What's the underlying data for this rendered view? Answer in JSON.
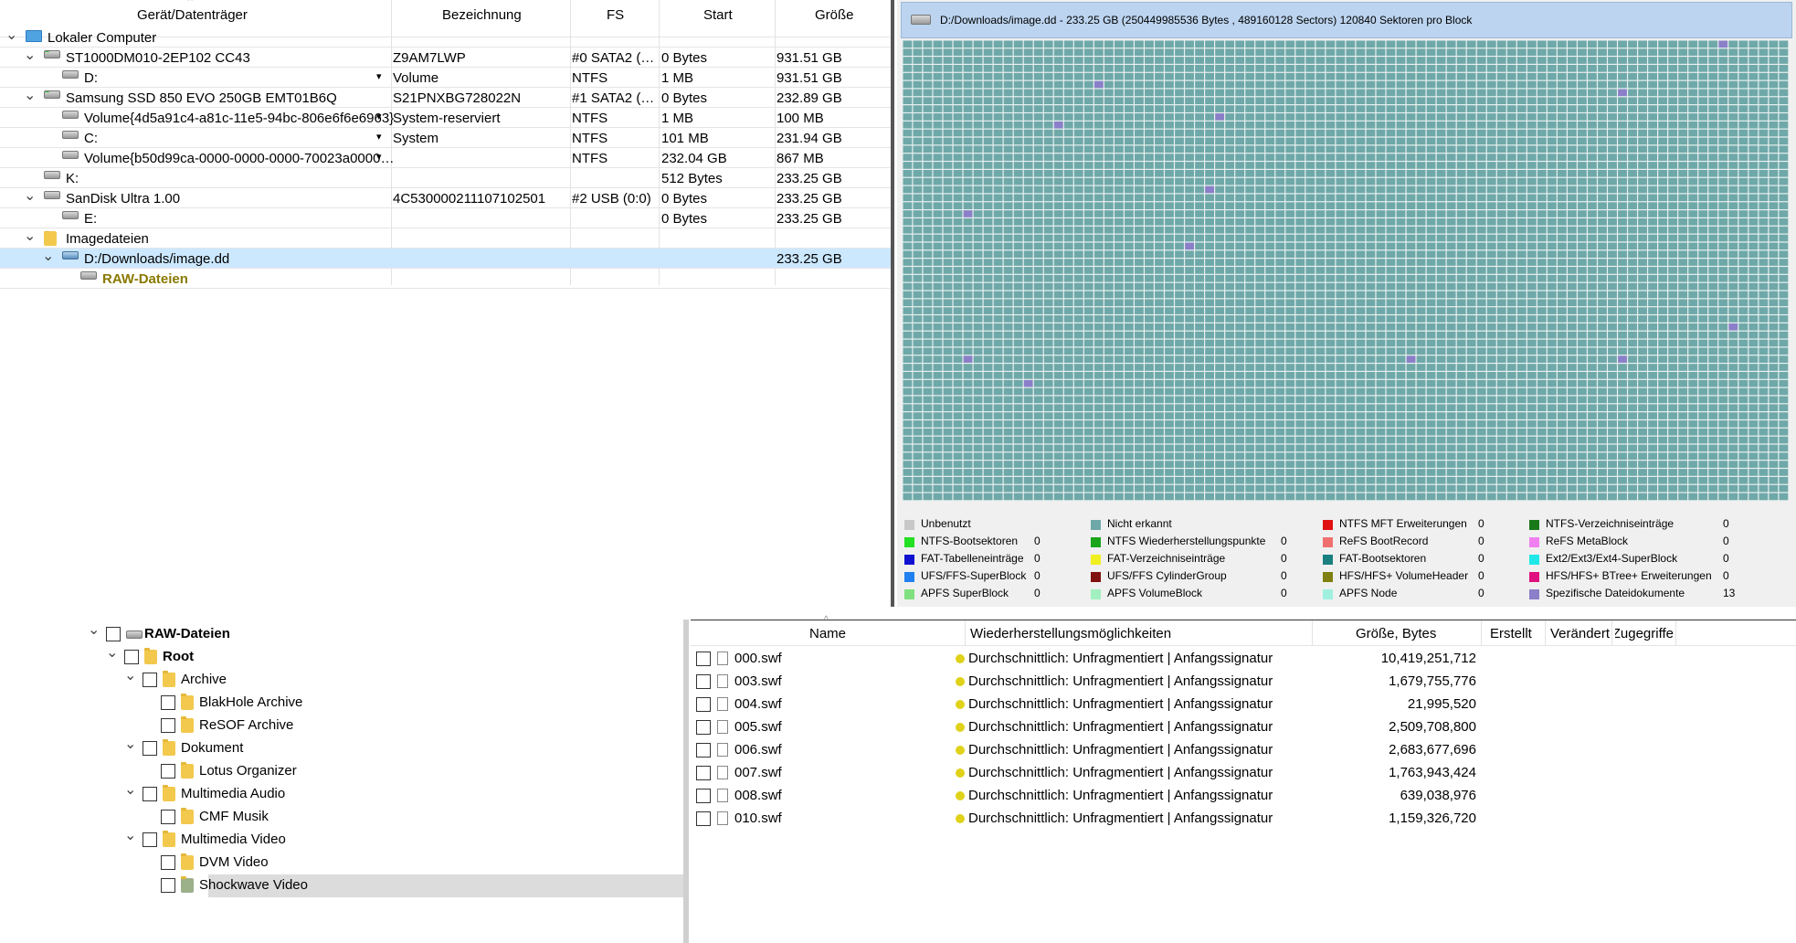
{
  "devices": {
    "columns": [
      "Gerät/Datenträger",
      "Bezeichnung",
      "FS",
      "Start",
      "Größe"
    ],
    "rows": [
      {
        "name": "Lokaler Computer",
        "label": "",
        "fs": "",
        "start": "",
        "size": ""
      },
      {
        "name": "ST1000DM010-2EP102 CC43",
        "label": "Z9AM7LWP",
        "fs": "#0 SATA2 (…",
        "start": "0 Bytes",
        "size": "931.51 GB"
      },
      {
        "name": "D:",
        "label": "Volume",
        "fs": "NTFS",
        "start": "1 MB",
        "size": "931.51 GB"
      },
      {
        "name": "Samsung SSD 850 EVO 250GB EMT01B6Q",
        "label": "S21PNXBG728022N",
        "fs": "#1 SATA2 (…",
        "start": "0 Bytes",
        "size": "232.89 GB"
      },
      {
        "name": "Volume{4d5a91c4-a81c-11e5-94bc-806e6f6e6963}",
        "label": "System-reserviert",
        "fs": "NTFS",
        "start": "1 MB",
        "size": "100 MB"
      },
      {
        "name": "C:",
        "label": "System",
        "fs": "NTFS",
        "start": "101 MB",
        "size": "231.94 GB"
      },
      {
        "name": "Volume{b50d99ca-0000-0000-0000-70023a0000…",
        "label": "",
        "fs": "NTFS",
        "start": "232.04 GB",
        "size": "867 MB"
      },
      {
        "name": "K:",
        "label": "",
        "fs": "",
        "start": "512 Bytes",
        "size": "233.25 GB"
      },
      {
        "name": "SanDisk Ultra 1.00",
        "label": "4C530000211107102501",
        "fs": "#2 USB (0:0)",
        "start": "0 Bytes",
        "size": "233.25 GB"
      },
      {
        "name": "E:",
        "label": "",
        "fs": "",
        "start": "0 Bytes",
        "size": "233.25 GB"
      },
      {
        "name": "Imagedateien",
        "label": "",
        "fs": "",
        "start": "",
        "size": ""
      },
      {
        "name": "D:/Downloads/image.dd",
        "label": "",
        "fs": "",
        "start": "",
        "size": "233.25 GB"
      },
      {
        "name": "RAW-Dateien",
        "label": "",
        "fs": "",
        "start": "",
        "size": ""
      }
    ]
  },
  "map": {
    "title": "D:/Downloads/image.dd - 233.25 GB (250449985536 Bytes , 489160128 Sectors) 120840 Sektoren pro Block",
    "colors": {
      "cell": "#6fa8a8",
      "grid": "#e8f0f0",
      "special": "#8a7fc8"
    },
    "legend": [
      {
        "label": "Unbenutzt",
        "count": "",
        "color": "#c8c8c8"
      },
      {
        "label": "Nicht erkannt",
        "count": "",
        "color": "#6fa8a8"
      },
      {
        "label": "NTFS MFT Erweiterungen",
        "count": "0",
        "color": "#e01010"
      },
      {
        "label": "NTFS-Verzeichniseinträge",
        "count": "0",
        "color": "#1a7a1a"
      },
      {
        "label": "NTFS-Bootsektoren",
        "count": "0",
        "color": "#22e022"
      },
      {
        "label": "NTFS Wiederherstellungspunkte",
        "count": "0",
        "color": "#1aa51a"
      },
      {
        "label": "ReFS BootRecord",
        "count": "0",
        "color": "#f07070"
      },
      {
        "label": "ReFS MetaBlock",
        "count": "0",
        "color": "#f080f0"
      },
      {
        "label": "FAT-Tabelleneinträge",
        "count": "0",
        "color": "#1010d0"
      },
      {
        "label": "FAT-Verzeichniseinträge",
        "count": "0",
        "color": "#f0f020"
      },
      {
        "label": "FAT-Bootsektoren",
        "count": "0",
        "color": "#1a8080"
      },
      {
        "label": "Ext2/Ext3/Ext4-SuperBlock",
        "count": "0",
        "color": "#20e8e8"
      },
      {
        "label": "UFS/FFS-SuperBlock",
        "count": "0",
        "color": "#2080f0"
      },
      {
        "label": "UFS/FFS CylinderGroup",
        "count": "0",
        "color": "#801010"
      },
      {
        "label": "HFS/HFS+ VolumeHeader",
        "count": "0",
        "color": "#808010"
      },
      {
        "label": "HFS/HFS+ BTree+ Erweiterungen",
        "count": "0",
        "color": "#e01080"
      },
      {
        "label": "APFS SuperBlock",
        "count": "0",
        "color": "#80e080"
      },
      {
        "label": "APFS VolumeBlock",
        "count": "0",
        "color": "#a0f0c0"
      },
      {
        "label": "APFS Node",
        "count": "0",
        "color": "#a0f0e0"
      },
      {
        "label": "Spezifische Dateidokumente",
        "count": "13",
        "color": "#8a7fc8"
      }
    ]
  },
  "tree": {
    "items": [
      {
        "label": "RAW-Dateien",
        "bold": true
      },
      {
        "label": "Root",
        "bold": true
      },
      {
        "label": "Archive"
      },
      {
        "label": "BlakHole Archive"
      },
      {
        "label": "ReSOF Archive"
      },
      {
        "label": "Dokument"
      },
      {
        "label": "Lotus Organizer"
      },
      {
        "label": "Multimedia Audio"
      },
      {
        "label": "CMF Musik"
      },
      {
        "label": "Multimedia Video"
      },
      {
        "label": "DVM Video"
      },
      {
        "label": "Shockwave Video"
      }
    ]
  },
  "files": {
    "columns": [
      "Name",
      "Wiederherstellungsmöglichkeiten",
      "Größe, Bytes",
      "Erstellt",
      "Verändert",
      "Zugegriffe"
    ],
    "rows": [
      {
        "name": "000.swf",
        "recovery": "Durchschnittlich: Unfragmentiert | Anfangssignatur",
        "size": "10,419,251,712"
      },
      {
        "name": "003.swf",
        "recovery": "Durchschnittlich: Unfragmentiert | Anfangssignatur",
        "size": "1,679,755,776"
      },
      {
        "name": "004.swf",
        "recovery": "Durchschnittlich: Unfragmentiert | Anfangssignatur",
        "size": "21,995,520"
      },
      {
        "name": "005.swf",
        "recovery": "Durchschnittlich: Unfragmentiert | Anfangssignatur",
        "size": "2,509,708,800"
      },
      {
        "name": "006.swf",
        "recovery": "Durchschnittlich: Unfragmentiert | Anfangssignatur",
        "size": "2,683,677,696"
      },
      {
        "name": "007.swf",
        "recovery": "Durchschnittlich: Unfragmentiert | Anfangssignatur",
        "size": "1,763,943,424"
      },
      {
        "name": "008.swf",
        "recovery": "Durchschnittlich: Unfragmentiert | Anfangssignatur",
        "size": "639,038,976"
      },
      {
        "name": "010.swf",
        "recovery": "Durchschnittlich: Unfragmentiert | Anfangssignatur",
        "size": "1,159,326,720"
      }
    ]
  }
}
